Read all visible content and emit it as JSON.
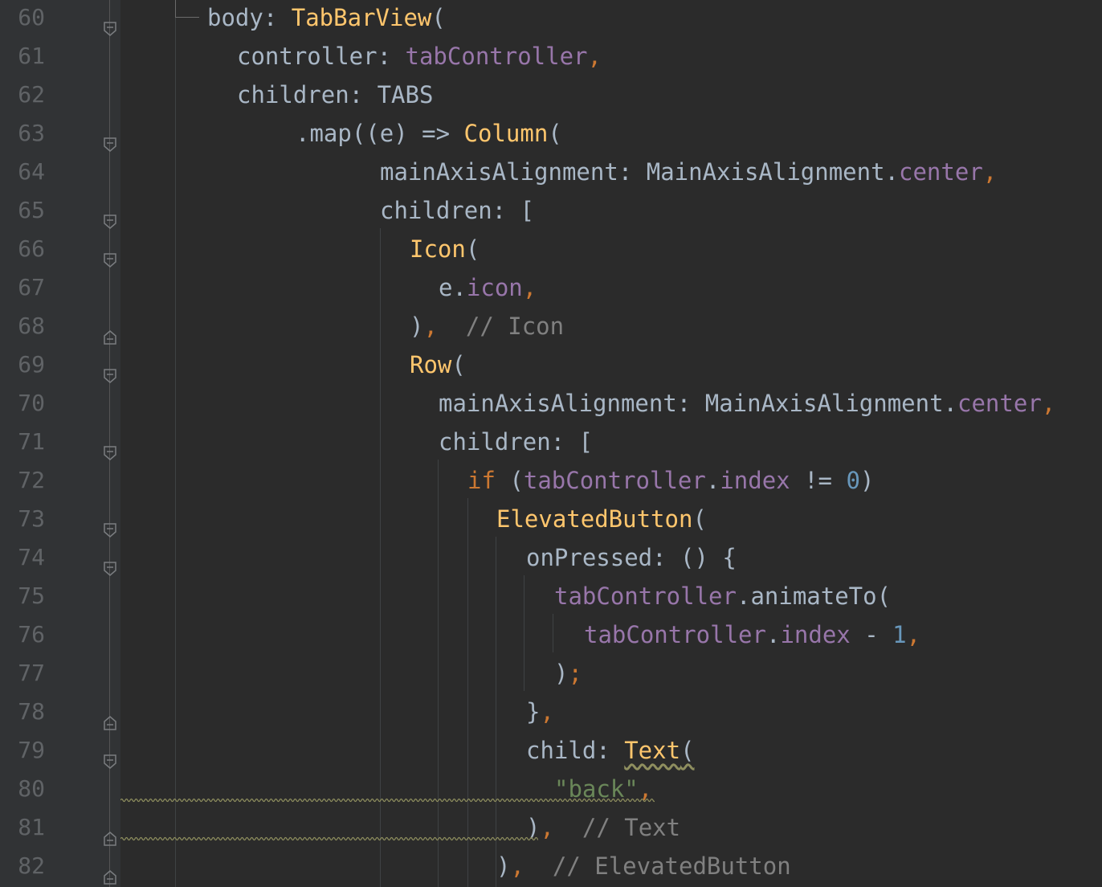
{
  "editor": {
    "colors": {
      "background": "#2b2b2b",
      "gutter": "#313335",
      "line_number": "#606366",
      "default_text": "#a9b7c6",
      "keyword": "#cc7832",
      "property": "#9876aa",
      "function": "#ffc66d",
      "number": "#6897bb",
      "string": "#6a8759",
      "comment": "#808080"
    },
    "lines": [
      {
        "num": "60",
        "fold": "fold-open-icon",
        "tokens": [
          {
            "t": "body: ",
            "c": "t"
          },
          {
            "t": "TabBarView",
            "c": "f"
          },
          {
            "t": "(",
            "c": "t"
          }
        ]
      },
      {
        "num": "61",
        "fold": "",
        "tokens": [
          {
            "t": "controller: ",
            "c": "t"
          },
          {
            "t": "tabController",
            "c": "p"
          },
          {
            "t": ",",
            "c": "k"
          }
        ]
      },
      {
        "num": "62",
        "fold": "",
        "tokens": [
          {
            "t": "children: TABS",
            "c": "t"
          }
        ]
      },
      {
        "num": "63",
        "fold": "fold-open-icon",
        "tokens": [
          {
            "t": ".map((e) => ",
            "c": "t"
          },
          {
            "t": "Column",
            "c": "f"
          },
          {
            "t": "(",
            "c": "t"
          }
        ]
      },
      {
        "num": "64",
        "fold": "",
        "tokens": [
          {
            "t": "mainAxisAlignment: MainAxisAlignment.",
            "c": "t"
          },
          {
            "t": "center",
            "c": "p"
          },
          {
            "t": ",",
            "c": "k"
          }
        ]
      },
      {
        "num": "65",
        "fold": "fold-open-icon",
        "tokens": [
          {
            "t": "children: [",
            "c": "t"
          }
        ]
      },
      {
        "num": "66",
        "fold": "fold-open-icon",
        "tokens": [
          {
            "t": "Icon",
            "c": "f"
          },
          {
            "t": "(",
            "c": "t"
          }
        ]
      },
      {
        "num": "67",
        "fold": "",
        "tokens": [
          {
            "t": "e.",
            "c": "t"
          },
          {
            "t": "icon",
            "c": "p"
          },
          {
            "t": ",",
            "c": "k"
          }
        ]
      },
      {
        "num": "68",
        "fold": "fold-close-icon",
        "tokens": [
          {
            "t": ")",
            "c": "t"
          },
          {
            "t": ",",
            "c": "k"
          },
          {
            "t": "  // Icon",
            "c": "c"
          }
        ]
      },
      {
        "num": "69",
        "fold": "fold-open-icon",
        "tokens": [
          {
            "t": "Row",
            "c": "f"
          },
          {
            "t": "(",
            "c": "t"
          }
        ]
      },
      {
        "num": "70",
        "fold": "",
        "tokens": [
          {
            "t": "mainAxisAlignment: MainAxisAlignment.",
            "c": "t"
          },
          {
            "t": "center",
            "c": "p"
          },
          {
            "t": ",",
            "c": "k"
          }
        ]
      },
      {
        "num": "71",
        "fold": "fold-open-icon",
        "tokens": [
          {
            "t": "children: [",
            "c": "t"
          }
        ]
      },
      {
        "num": "72",
        "fold": "",
        "tokens": [
          {
            "t": "if ",
            "c": "k"
          },
          {
            "t": "(",
            "c": "t"
          },
          {
            "t": "tabController",
            "c": "p"
          },
          {
            "t": ".",
            "c": "t"
          },
          {
            "t": "index",
            "c": "p"
          },
          {
            "t": " != ",
            "c": "t"
          },
          {
            "t": "0",
            "c": "n"
          },
          {
            "t": ")",
            "c": "t"
          }
        ]
      },
      {
        "num": "73",
        "fold": "fold-open-icon",
        "tokens": [
          {
            "t": "ElevatedButton",
            "c": "f"
          },
          {
            "t": "(",
            "c": "t"
          }
        ]
      },
      {
        "num": "74",
        "fold": "fold-open-icon",
        "tokens": [
          {
            "t": "onPressed: () {",
            "c": "t"
          }
        ]
      },
      {
        "num": "75",
        "fold": "",
        "tokens": [
          {
            "t": "tabController",
            "c": "p"
          },
          {
            "t": ".animateTo(",
            "c": "t"
          }
        ]
      },
      {
        "num": "76",
        "fold": "",
        "tokens": [
          {
            "t": "tabController",
            "c": "p"
          },
          {
            "t": ".",
            "c": "t"
          },
          {
            "t": "index",
            "c": "p"
          },
          {
            "t": " - ",
            "c": "t"
          },
          {
            "t": "1",
            "c": "n"
          },
          {
            "t": ",",
            "c": "k"
          }
        ]
      },
      {
        "num": "77",
        "fold": "",
        "tokens": [
          {
            "t": ")",
            "c": "t"
          },
          {
            "t": ";",
            "c": "k"
          }
        ]
      },
      {
        "num": "78",
        "fold": "fold-close-icon",
        "tokens": [
          {
            "t": "}",
            "c": "t"
          },
          {
            "t": ",",
            "c": "k"
          }
        ]
      },
      {
        "num": "79",
        "fold": "fold-open-icon",
        "tokens": [
          {
            "t": "child: ",
            "c": "t"
          },
          {
            "t": "Text",
            "c": "f warn"
          },
          {
            "t": "(",
            "c": "t warn"
          }
        ]
      },
      {
        "num": "80",
        "fold": "",
        "tokens": [
          {
            "t": "\"back\"",
            "c": "s"
          },
          {
            "t": ",",
            "c": "k"
          }
        ]
      },
      {
        "num": "81",
        "fold": "fold-close-icon",
        "tokens": [
          {
            "t": ")",
            "c": "t"
          },
          {
            "t": ",",
            "c": "k"
          },
          {
            "t": "  // Text",
            "c": "c"
          }
        ]
      },
      {
        "num": "82",
        "fold": "fold-close-icon",
        "tokens": [
          {
            "t": ")",
            "c": "t"
          },
          {
            "t": ",",
            "c": "k"
          },
          {
            "t": "  // ElevatedButton",
            "c": "c"
          }
        ]
      }
    ]
  }
}
